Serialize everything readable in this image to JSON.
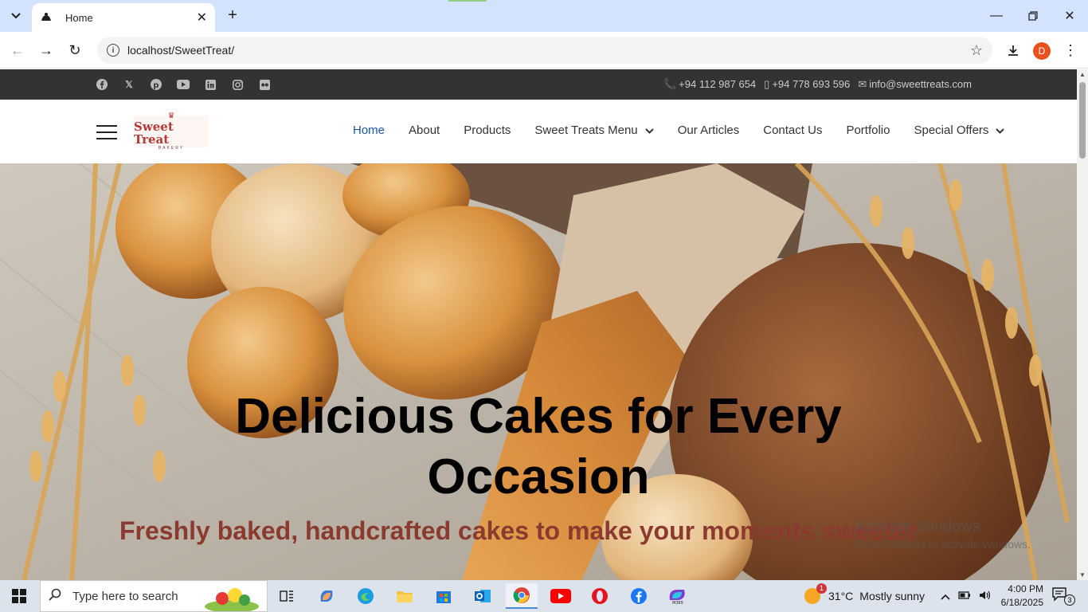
{
  "browser": {
    "tab_title": "Home",
    "url": "localhost/SweetTreat/",
    "profile_initial": "D"
  },
  "topbar": {
    "social_icons": [
      "facebook-icon",
      "x-icon",
      "pinterest-icon",
      "youtube-icon",
      "linkedin-icon",
      "instagram-icon",
      "flickr-icon"
    ],
    "phone": "+94 112 987 654",
    "mobile": "+94 778 693 596",
    "email": "info@sweettreats.com"
  },
  "nav": {
    "logo_text": "Sweet Treat",
    "logo_sub": "BAKERY",
    "items": [
      {
        "label": "Home",
        "active": true
      },
      {
        "label": "About"
      },
      {
        "label": "Products"
      },
      {
        "label": "Sweet Treats Menu",
        "dropdown": true
      },
      {
        "label": "Our Articles"
      },
      {
        "label": "Contact Us"
      },
      {
        "label": "Portfolio"
      },
      {
        "label": "Special Offers",
        "dropdown": true
      }
    ]
  },
  "hero": {
    "title": "Delicious Cakes for Every Occasion",
    "subtitle": "Freshly baked, handcrafted cakes to make your moments sweeter"
  },
  "watermark": {
    "line1": "Activate Windows",
    "line2": "Go to Settings to activate Windows."
  },
  "taskbar": {
    "search_placeholder": "Type here to search",
    "weather_temp": "31°C",
    "weather_desc": "Mostly sunny",
    "weather_badge": "1",
    "time": "4:00 PM",
    "date": "6/18/2025",
    "notif_count": "3"
  },
  "colors": {
    "accent": "#1e56a8",
    "topbar_bg": "#333333",
    "subtitle": "#8a3a2e",
    "tabbar_bg": "#d3e3fd"
  }
}
